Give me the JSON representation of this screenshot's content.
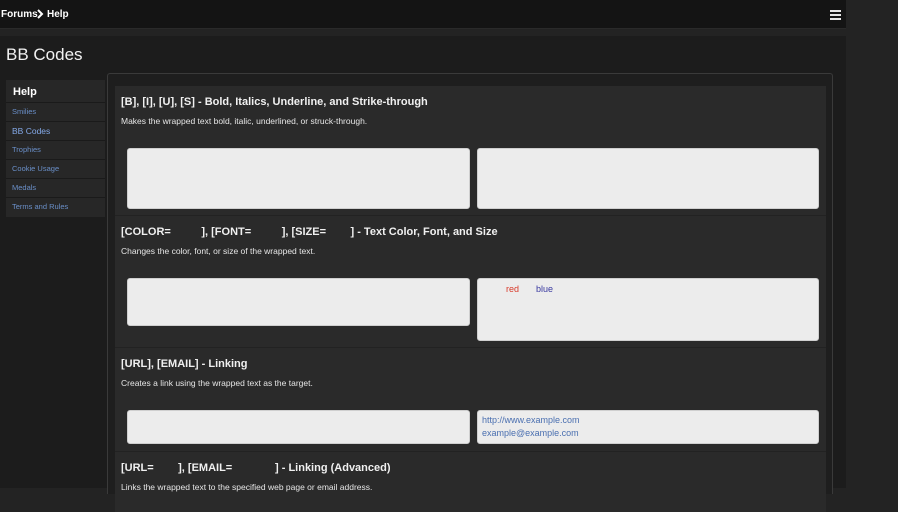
{
  "breadcrumb": {
    "forums": "Forums",
    "help": "Help"
  },
  "page_title": "BB Codes",
  "sidebar": {
    "header": "Help",
    "items": [
      {
        "label": "Smilies",
        "active": false
      },
      {
        "label": "BB Codes",
        "active": true
      },
      {
        "label": "Trophies",
        "active": false
      },
      {
        "label": "Cookie Usage",
        "active": false
      },
      {
        "label": "Medals",
        "active": false
      },
      {
        "label": "Terms and Rules",
        "active": false
      }
    ]
  },
  "sections": [
    {
      "title": "[B], [I], [U], [S] - Bold, Italics, Underline, and Strike-through",
      "description": "Makes the wrapped text bold, italic, underlined, or struck-through."
    },
    {
      "title": "[COLOR=          ], [FONT=          ], [SIZE=        ] - Text Color, Font, and Size",
      "description": "Changes the color, font, or size of the wrapped text.",
      "output": {
        "red": "red",
        "blue": "blue"
      }
    },
    {
      "title": "[URL], [EMAIL] - Linking",
      "description": "Creates a link using the wrapped text as the target.",
      "output": {
        "url": "http://www.example.com",
        "email": "example@example.com"
      }
    },
    {
      "title": "[URL=        ], [EMAIL=              ] - Linking (Advanced)",
      "description": "Links the wrapped text to the specified web page or email address."
    }
  ],
  "colors": {
    "background": "#232323",
    "link": "#6a8fc8",
    "red_text": "#d83a2a",
    "blue_text": "#3a3aa0",
    "url_text": "#4a6fb0"
  }
}
